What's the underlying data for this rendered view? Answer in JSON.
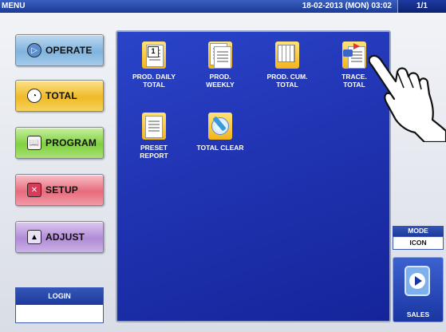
{
  "header": {
    "title": "MENU",
    "datetime": "18-02-2013 (MON) 03:02",
    "page": "1/1"
  },
  "sidebar": {
    "buttons": [
      {
        "label": "OPERATE",
        "icon": "play-icon"
      },
      {
        "label": "TOTAL",
        "icon": "clock-icon"
      },
      {
        "label": "PROGRAM",
        "icon": "book-icon"
      },
      {
        "label": "SETUP",
        "icon": "wrench-icon"
      },
      {
        "label": "ADJUST",
        "icon": "scale-icon"
      }
    ],
    "login": {
      "label": "LOGIN",
      "value": ""
    }
  },
  "menu": {
    "items": [
      {
        "line1": "PROD. DAILY",
        "line2": "TOTAL",
        "icon": "calendar-report-icon"
      },
      {
        "line1": "PROD.",
        "line2": "WEEKLY",
        "icon": "weekly-report-icon"
      },
      {
        "line1": "PROD. CUM.",
        "line2": "TOTAL",
        "icon": "cumulative-report-icon"
      },
      {
        "line1": "TRACE.",
        "line2": "TOTAL",
        "icon": "trace-report-icon"
      },
      {
        "line1": "PRESET",
        "line2": "REPORT",
        "icon": "preset-report-icon"
      },
      {
        "line1": "TOTAL CLEAR",
        "line2": "",
        "icon": "clear-icon"
      }
    ]
  },
  "mode": {
    "label": "MODE",
    "value": "ICON"
  },
  "sales": {
    "label": "SALES"
  },
  "colors": {
    "panel": "#1f32b0",
    "header": "#1b3a94"
  }
}
